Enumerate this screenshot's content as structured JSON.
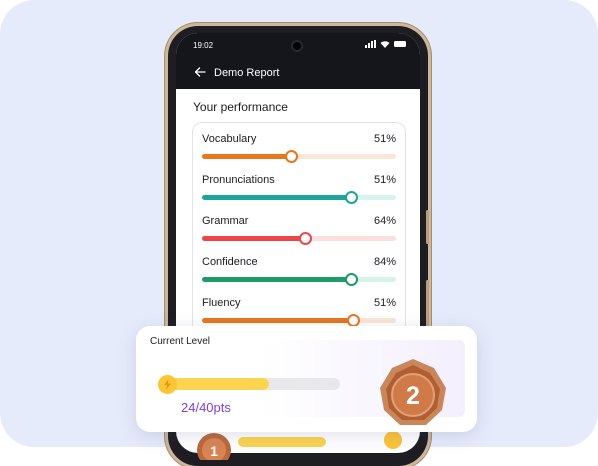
{
  "status": {
    "time": "19:02"
  },
  "header": {
    "title": "Demo Report",
    "back_icon": "arrow-left-icon"
  },
  "section": {
    "title": "Your performance"
  },
  "metrics": [
    {
      "label": "Vocabulary",
      "percent_text": "51%",
      "value": 0.46,
      "fill_color": "#e8761d",
      "track_color": "#fbe5d6"
    },
    {
      "label": "Pronunciations",
      "percent_text": "51%",
      "value": 0.77,
      "fill_color": "#1ea59b",
      "track_color": "#d6f3ee"
    },
    {
      "label": "Grammar",
      "percent_text": "64%",
      "value": 0.53,
      "fill_color": "#ec4646",
      "track_color": "#fbdedd"
    },
    {
      "label": "Confidence",
      "percent_text": "84%",
      "value": 0.77,
      "fill_color": "#1f9a69",
      "track_color": "#d4f4e5"
    },
    {
      "label": "Fluency",
      "percent_text": "51%",
      "value": 0.78,
      "fill_color": "#e8761d",
      "track_color": "#fbe5d6"
    }
  ],
  "level": {
    "title": "Current Level",
    "points_text": "24/40pts",
    "progress": 0.6,
    "level_number": "2",
    "accent": "#7b3fe4"
  },
  "peek": {
    "medal_number": "1"
  },
  "colors": {
    "background": "#e6ebfb",
    "header_dark": "#15161b"
  }
}
